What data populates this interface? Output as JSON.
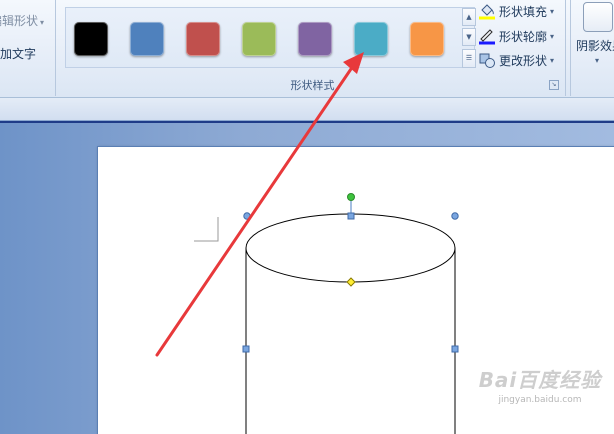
{
  "ribbon": {
    "left_group": {
      "cmd_edit_shape": "编辑形状",
      "cmd_add_text": "添加文字"
    },
    "shape_styles": {
      "label": "形状样式",
      "swatches": [
        {
          "name": "black",
          "color": "#000000"
        },
        {
          "name": "blue",
          "color": "#4f81bd"
        },
        {
          "name": "red",
          "color": "#c0504d"
        },
        {
          "name": "green",
          "color": "#9bbb59"
        },
        {
          "name": "purple",
          "color": "#8064a2"
        },
        {
          "name": "aqua",
          "color": "#4bacc6"
        },
        {
          "name": "orange",
          "color": "#f79646"
        }
      ],
      "shape_fill": "形状填充",
      "shape_outline": "形状轮廓",
      "change_shape": "更改形状"
    },
    "shadow_group": {
      "label": "阴影效果"
    }
  },
  "annotation": {
    "arrow_color": "#e8393b",
    "points_to": "aqua"
  },
  "watermark": {
    "main": "Bai百度经验",
    "sub": "jingyan.baidu.com"
  }
}
